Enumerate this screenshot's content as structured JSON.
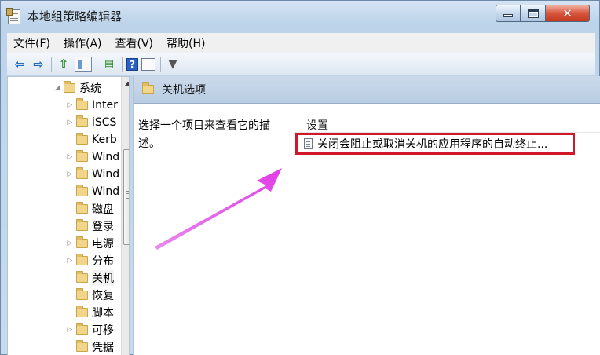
{
  "window": {
    "title": "本地组策略编辑器"
  },
  "menu": [
    "文件(F)",
    "操作(A)",
    "查看(V)",
    "帮助(H)"
  ],
  "toolbar": {
    "icons": [
      "back-arrow-icon",
      "forward-arrow-icon",
      "up-folder-icon",
      "show-hide-tree-icon",
      "export-list-icon",
      "help-icon",
      "view-icon",
      "filter-icon"
    ]
  },
  "tree": {
    "items": [
      {
        "label": "系统",
        "expander": "expanded"
      },
      {
        "label": "Inter",
        "expander": "collapsed"
      },
      {
        "label": "iSCS",
        "expander": "collapsed"
      },
      {
        "label": "Kerb",
        "expander": "none"
      },
      {
        "label": "Wind",
        "expander": "collapsed"
      },
      {
        "label": "Wind",
        "expander": "collapsed"
      },
      {
        "label": "Wind",
        "expander": "none"
      },
      {
        "label": "磁盘",
        "expander": "none"
      },
      {
        "label": "登录",
        "expander": "none"
      },
      {
        "label": "电源",
        "expander": "collapsed"
      },
      {
        "label": "分布",
        "expander": "collapsed"
      },
      {
        "label": "关机",
        "expander": "none",
        "selected": true
      },
      {
        "label": "恢复",
        "expander": "none"
      },
      {
        "label": "脚本",
        "expander": "none"
      },
      {
        "label": "可移",
        "expander": "collapsed"
      },
      {
        "label": "凭据",
        "expander": "none"
      }
    ]
  },
  "right": {
    "header_title": "关机选项",
    "description": "选择一个项目来查看它的描述。",
    "column_header": "设置",
    "setting_label": "关闭会阻止或取消关机的应用程序的自动终止...",
    "highlight_color": "#d1182b"
  },
  "annotation": {
    "arrow_color": "#e23be8"
  }
}
